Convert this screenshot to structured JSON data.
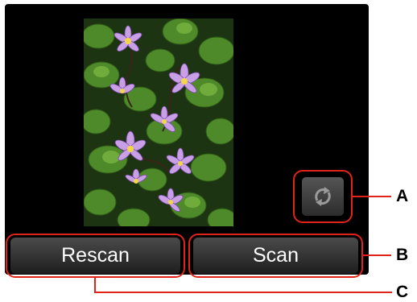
{
  "buttons": {
    "rescan_label": "Rescan",
    "scan_label": "Scan"
  },
  "rotate_button": {
    "icon": "rotate-icon"
  },
  "callouts": {
    "a": "A",
    "b": "B",
    "c": "C"
  },
  "colors": {
    "callout_red": "#e2231a",
    "screen_bg": "#000000",
    "button_bg": "#2c2c2c"
  }
}
